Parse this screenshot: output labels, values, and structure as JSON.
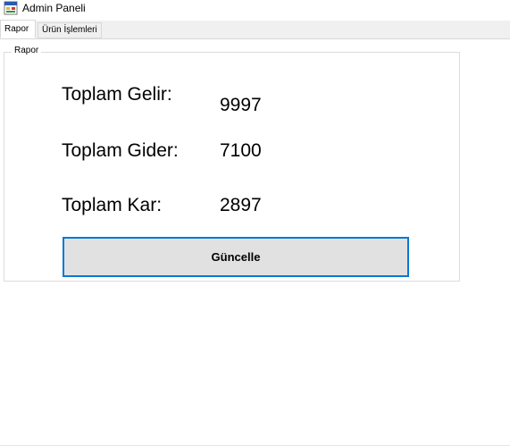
{
  "window": {
    "title": "Admin Paneli"
  },
  "tabs": [
    {
      "label": "Rapor",
      "active": true
    },
    {
      "label": "Ürün İşlemleri",
      "active": false
    }
  ],
  "report": {
    "group_title": "Rapor",
    "rows": [
      {
        "label": "Toplam Gelir:",
        "value": "9997"
      },
      {
        "label": "Toplam Gider:",
        "value": "7100"
      },
      {
        "label": "Toplam Kar:",
        "value": "2897"
      }
    ],
    "update_button_label": "Güncelle"
  },
  "colors": {
    "accent": "#0078d7",
    "button_bg": "#e1e1e1",
    "tabstrip_bg": "#f0f0f0"
  }
}
